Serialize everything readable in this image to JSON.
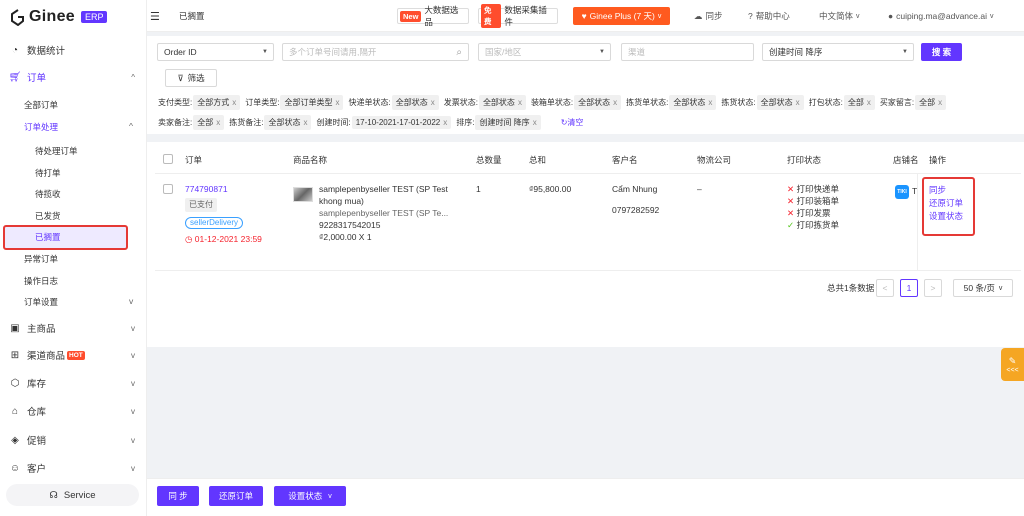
{
  "app": {
    "brand": "Ginee",
    "badge": "ERP",
    "page_title": "已搁置"
  },
  "colors": {
    "accent": "#6236ff",
    "danger": "#f5222d",
    "promo": "#ff5a1f"
  },
  "sidebar": {
    "items": [
      {
        "label": "数据统计",
        "icon": "chart-icon"
      },
      {
        "label": "订单",
        "icon": "cart-icon"
      },
      {
        "label": "主商品",
        "icon": "bag-icon"
      },
      {
        "label": "渠道商品",
        "icon": "sitemap-icon",
        "badge": "HOT"
      },
      {
        "label": "库存",
        "icon": "cube-icon"
      },
      {
        "label": "仓库",
        "icon": "warehouse-icon"
      },
      {
        "label": "促销",
        "icon": "tag-icon"
      },
      {
        "label": "客户",
        "icon": "users-icon"
      }
    ],
    "order_sub": [
      "全部订单",
      "订单处理",
      "异常订单",
      "操作日志",
      "订单设置"
    ],
    "process_sub": [
      "待处理订单",
      "待打单",
      "待揽收",
      "已发货",
      "已搁置"
    ],
    "service_label": "Service"
  },
  "topbar": {
    "promo1_tag": "New",
    "promo1_label": "大数据选品",
    "promo2_tag": "免费",
    "promo2_label": "数据采集插件",
    "plus_label": "Ginee Plus (7 天)",
    "sync": "同步",
    "help": "帮助中心",
    "lang": "中文简体",
    "user": "cuiping.ma@advance.ai"
  },
  "filters": {
    "search_type": "Order ID",
    "search_placeholder": "多个订单号间请用,隔开",
    "country_placeholder": "国家/地区",
    "channel_placeholder": "渠道",
    "sort": "创建时间 降序",
    "search_button": "搜 索",
    "filter_button": "筛选",
    "row1": [
      {
        "label": "支付类型:",
        "value": "全部方式"
      },
      {
        "label": "订单类型:",
        "value": "全部订单类型"
      },
      {
        "label": "快递单状态:",
        "value": "全部状态"
      },
      {
        "label": "发票状态:",
        "value": "全部状态"
      },
      {
        "label": "装箱单状态:",
        "value": "全部状态"
      },
      {
        "label": "拣货单状态:",
        "value": "全部状态"
      },
      {
        "label": "拣货状态:",
        "value": "全部状态"
      },
      {
        "label": "打包状态:",
        "value": "全部"
      },
      {
        "label": "买家留言:",
        "value": "全部"
      }
    ],
    "row2": [
      {
        "label": "卖家备注:",
        "value": "全部"
      },
      {
        "label": "拣货备注:",
        "value": "全部状态"
      },
      {
        "label": "创建时间:",
        "value": "17-10-2021-17-01-2022"
      },
      {
        "label": "排序:",
        "value": "创建时间 降序"
      }
    ],
    "clear_label": "清空"
  },
  "table": {
    "headers": [
      "订单",
      "商品名称",
      "总数量",
      "总和",
      "客户名",
      "物流公司",
      "打印状态",
      "店铺名",
      "操作"
    ],
    "row": {
      "order_id": "774790871",
      "pay_status": "已支付",
      "tag": "sellerDelivery",
      "time": "01-12-2021 23:59",
      "product_title": "samplepenbyseller TEST (SP Test",
      "product_title2": "khong mua)",
      "product_variant": "samplepenbyseller TEST (SP Te...",
      "product_sku": "9228317542015",
      "product_price": "₫2,000.00 X 1",
      "qty": "1",
      "total": "₫95,800.00",
      "customer": "Cẩm Nhung",
      "phone": "0797282592",
      "logistics": "–",
      "print": [
        {
          "mark": "✕",
          "label": "打印快递单",
          "ok": false
        },
        {
          "mark": "✕",
          "label": "打印装箱单",
          "ok": false
        },
        {
          "mark": "✕",
          "label": "打印发票",
          "ok": false
        },
        {
          "mark": "✓",
          "label": "打印拣货单",
          "ok": true
        }
      ],
      "shop_icon": "TIKI",
      "shop_initial": "T",
      "actions": [
        "同步",
        "还原订单",
        "设置状态"
      ]
    },
    "pagination": {
      "total_label": "总共1条数据",
      "page": "1",
      "per_page": "50 条/页"
    }
  },
  "bottom": {
    "sync": "同 步",
    "restore": "还原订单",
    "set_status": "设置状态"
  },
  "float_label": "<<<"
}
